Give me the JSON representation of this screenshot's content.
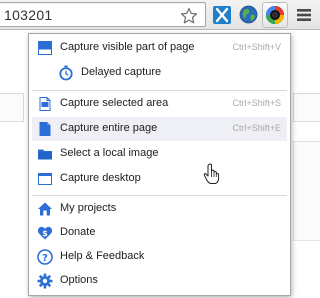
{
  "toolbar": {
    "omnibox_text": "103201",
    "star_icon": "bookmark-star-icon",
    "extensions": [
      "x-extension-icon",
      "globe-icon",
      "screenshot-extension-icon",
      "chrome-menu-icon"
    ]
  },
  "menu": {
    "items": [
      {
        "label": "Capture visible part of page",
        "shortcut": "Ctrl+Shift+V",
        "icon": "visible-area-icon"
      },
      {
        "label": "Delayed capture",
        "shortcut": "",
        "icon": "clock-icon"
      },
      {
        "label": "Capture selected area",
        "shortcut": "Ctrl+Shift+S",
        "icon": "selected-area-icon"
      },
      {
        "label": "Capture entire page",
        "shortcut": "Ctrl+Shift+E",
        "icon": "entire-page-icon"
      },
      {
        "label": "Select a local image",
        "shortcut": "",
        "icon": "folder-icon"
      },
      {
        "label": "Capture desktop",
        "shortcut": "",
        "icon": "desktop-window-icon"
      },
      {
        "label": "My projects",
        "shortcut": "",
        "icon": "home-icon"
      },
      {
        "label": "Donate",
        "shortcut": "",
        "icon": "heart-dollar-icon"
      },
      {
        "label": "Help & Feedback",
        "shortcut": "",
        "icon": "help-icon"
      },
      {
        "label": "Options",
        "shortcut": "",
        "icon": "gear-icon"
      }
    ],
    "hovered_item": "Capture entire page"
  },
  "colors": {
    "icon_blue": "#2b6fd6",
    "hover_bg": "#eef0f6",
    "shortcut_gray": "#a9a9a9"
  }
}
